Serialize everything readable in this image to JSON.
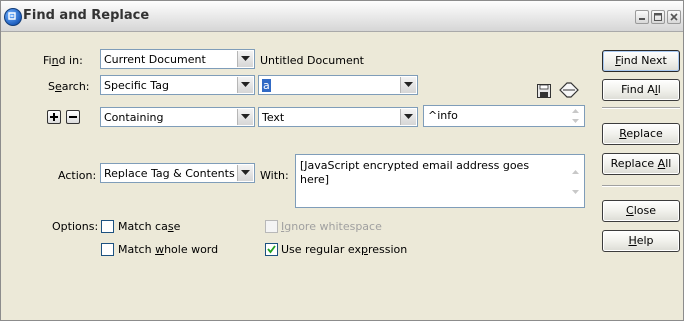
{
  "window": {
    "title": "Find and Replace"
  },
  "find_in": {
    "label_pre": "Fi",
    "label_u": "n",
    "label_post": "d in:",
    "value": "Current Document",
    "document_name": "Untitled Document"
  },
  "search": {
    "label_pre": "S",
    "label_u": "e",
    "label_post": "arch:",
    "value": "Specific Tag",
    "tag_value": "a"
  },
  "condition": {
    "operator_value": "Containing",
    "target_value": "Text",
    "text_value": "^info"
  },
  "action": {
    "label": "Action:",
    "value": "Replace Tag & Contents",
    "with_label": "With:",
    "with_value": "[JavaScript encrypted email address goes here]"
  },
  "options": {
    "label": "Options:",
    "match_case": {
      "pre": "Match ca",
      "u": "s",
      "post": "e",
      "checked": false
    },
    "ignore_whitespace": {
      "pre": "",
      "u": "I",
      "post": "gnore whitespace",
      "checked": false,
      "disabled": true
    },
    "match_whole_word": {
      "pre": "Match ",
      "u": "w",
      "post": "hole word",
      "checked": false
    },
    "use_regex": {
      "pre": "Use regular ex",
      "u": "p",
      "post": "ression",
      "checked": true
    }
  },
  "buttons": {
    "find_next": {
      "u": "F",
      "post": "ind Next"
    },
    "find_all": {
      "pre": "Find A",
      "u": "l",
      "post": "l"
    },
    "replace": {
      "u": "R",
      "post": "eplace"
    },
    "replace_all": {
      "pre": "Replace ",
      "u": "A",
      "post": "ll"
    },
    "close": {
      "u": "C",
      "post": "lose"
    },
    "help": {
      "u": "H",
      "post": "elp"
    }
  },
  "icons": {
    "app": "dreamweaver-app-icon",
    "save_query": "floppy-disk-icon",
    "load_query": "open-folder-icon",
    "add_condition": "plus-icon",
    "remove_condition": "minus-icon",
    "dropdown": "chevron-down-icon"
  }
}
